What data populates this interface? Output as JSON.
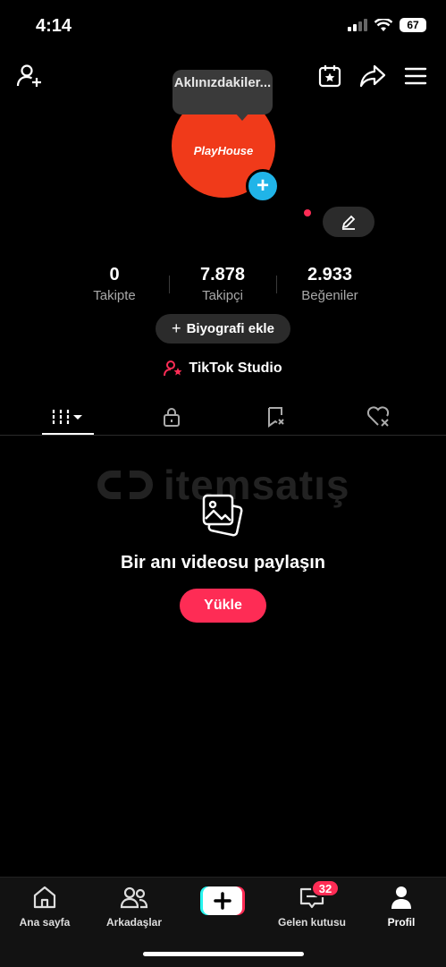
{
  "status_bar": {
    "time": "4:14",
    "battery": "67"
  },
  "profile": {
    "bubble_text": "Aklınızdakiler...",
    "avatar_logo": "PlayHouse"
  },
  "stats": [
    {
      "value": "0",
      "label": "Takipte"
    },
    {
      "value": "7.878",
      "label": "Takipçi"
    },
    {
      "value": "2.933",
      "label": "Beğeniler"
    }
  ],
  "bio_button": "Biyografi ekle",
  "studio_link": "TikTok Studio",
  "watermark": "itemsatış",
  "empty_state": {
    "title": "Bir anı videosu paylaşın",
    "upload_label": "Yükle"
  },
  "bottom_nav": {
    "home": "Ana sayfa",
    "friends": "Arkadaşlar",
    "inbox": "Gelen kutusu",
    "profile": "Profil",
    "inbox_badge": "32"
  },
  "colors": {
    "accent": "#fe2c55",
    "avatar_bg": "#f03a1a",
    "plus_blue": "#20b4e8"
  }
}
